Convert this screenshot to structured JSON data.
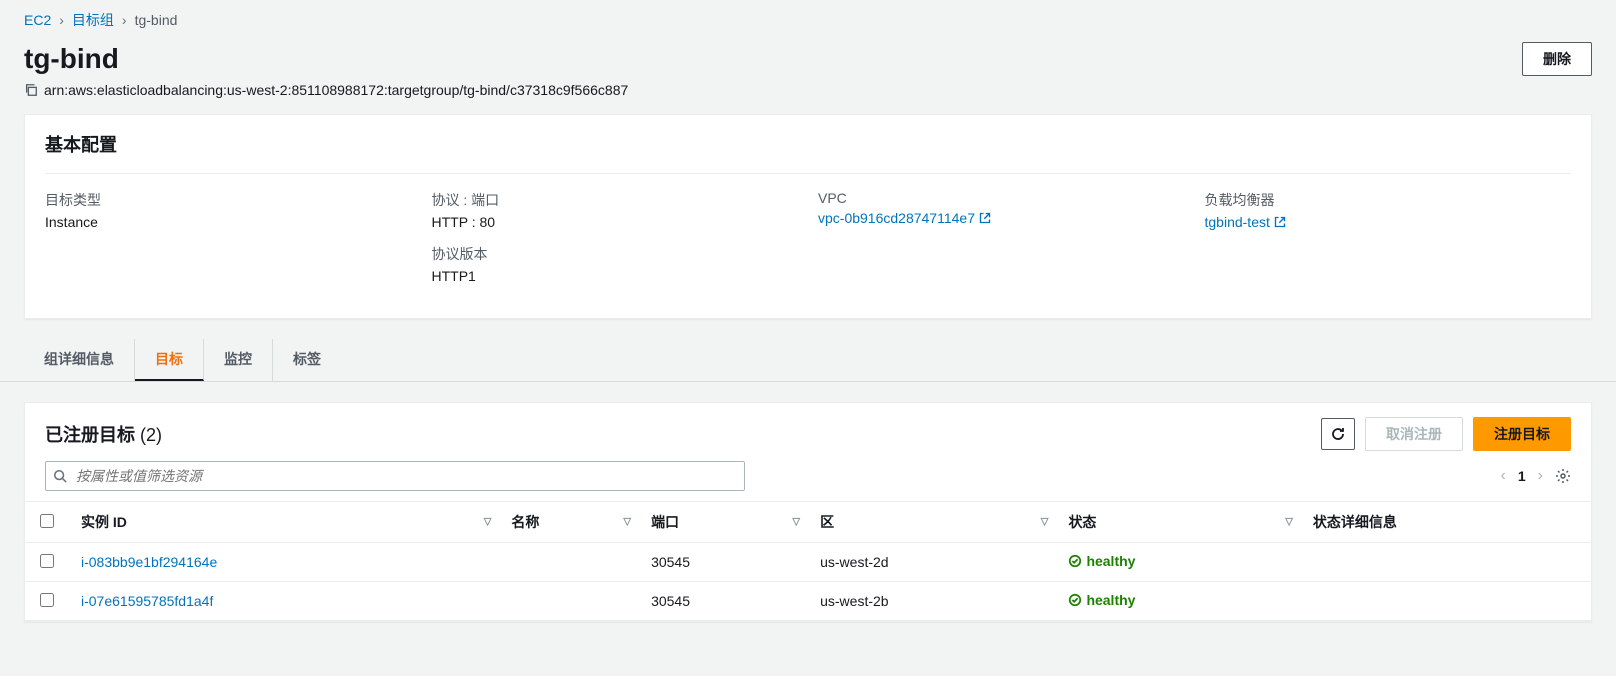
{
  "breadcrumb": {
    "root": "EC2",
    "level1": "目标组",
    "current": "tg-bind"
  },
  "page": {
    "title": "tg-bind",
    "delete_btn": "删除",
    "arn": "arn:aws:elasticloadbalancing:us-west-2:851108988172:targetgroup/tg-bind/c37318c9f566c887"
  },
  "config": {
    "section_title": "基本配置",
    "target_type_label": "目标类型",
    "target_type_value": "Instance",
    "protocol_port_label": "协议 : 端口",
    "protocol_port_value": "HTTP : 80",
    "protocol_version_label": "协议版本",
    "protocol_version_value": "HTTP1",
    "vpc_label": "VPC",
    "vpc_value": "vpc-0b916cd28747114e7",
    "lb_label": "负载均衡器",
    "lb_value": "tgbind-test"
  },
  "tabs": {
    "details": "组详细信息",
    "targets": "目标",
    "monitoring": "监控",
    "tags": "标签"
  },
  "targets": {
    "title": "已注册目标",
    "count": "(2)",
    "deregister": "取消注册",
    "register": "注册目标",
    "search_placeholder": "按属性或值筛选资源",
    "page": "1",
    "cols": {
      "instance_id": "实例 ID",
      "name": "名称",
      "port": "端口",
      "zone": "区",
      "status": "状态",
      "status_details": "状态详细信息"
    },
    "rows": [
      {
        "id": "i-083bb9e1bf294164e",
        "name": "",
        "port": "30545",
        "zone": "us-west-2d",
        "status": "healthy"
      },
      {
        "id": "i-07e61595785fd1a4f",
        "name": "",
        "port": "30545",
        "zone": "us-west-2b",
        "status": "healthy"
      }
    ]
  }
}
